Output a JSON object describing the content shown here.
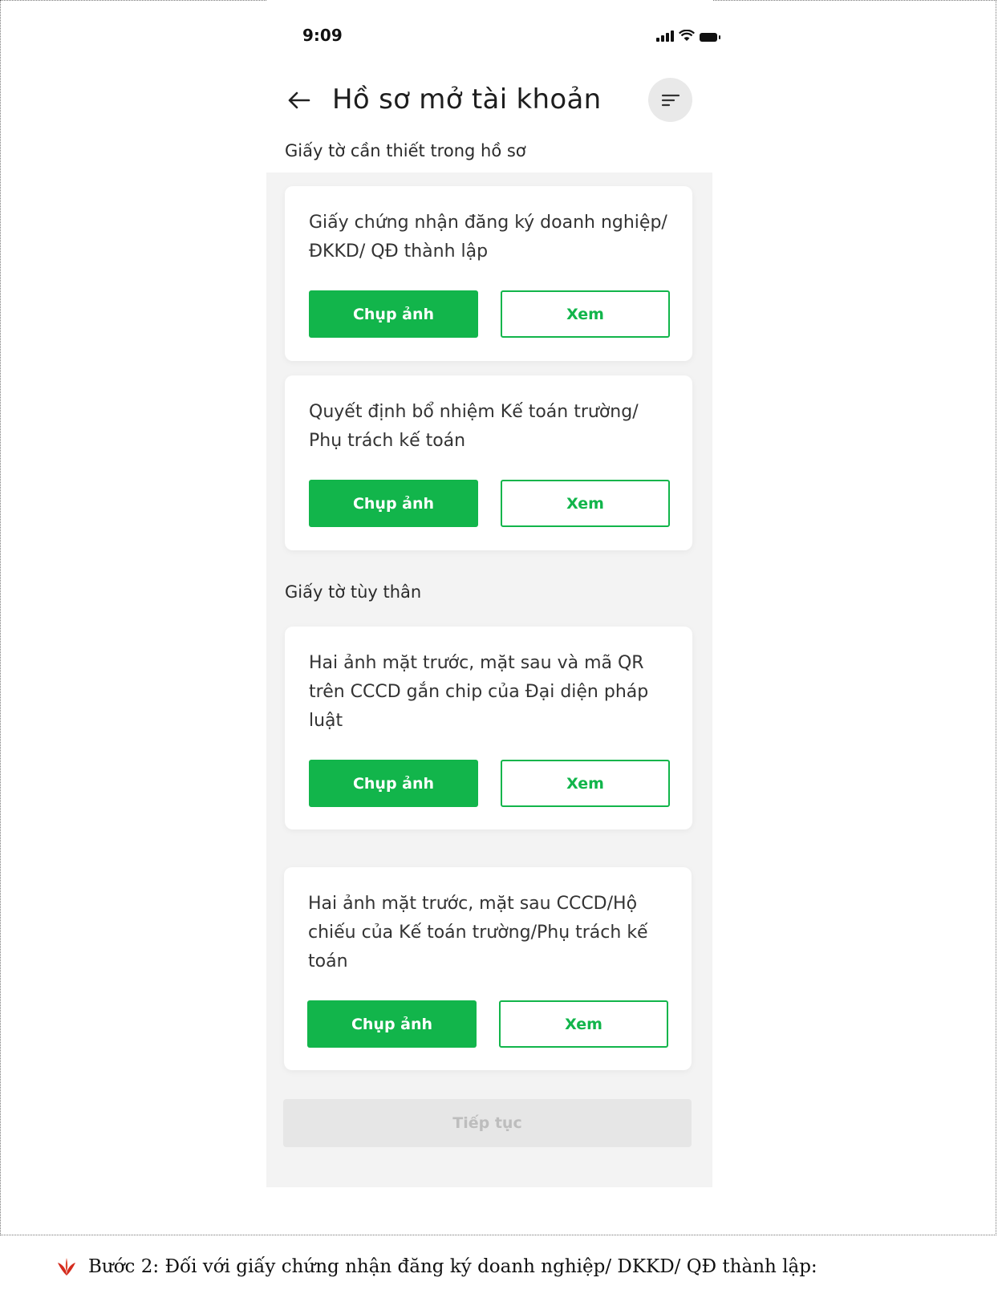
{
  "status_bar": {
    "time": "9:09"
  },
  "header": {
    "title": "Hồ sơ mở tài khoản"
  },
  "sections": [
    {
      "title": "Giấy tờ cần thiết trong hồ sơ",
      "cards": [
        {
          "text": "Giấy chứng nhận đăng ký doanh nghiệp/ ĐKKD/ QĐ thành lập",
          "primary": "Chụp ảnh",
          "secondary": "Xem"
        },
        {
          "text": "Quyết định bổ nhiệm Kế toán trường/ Phụ trách kế toán",
          "primary": "Chụp ảnh",
          "secondary": "Xem"
        }
      ]
    },
    {
      "title": "Giấy tờ tùy thân",
      "cards": [
        {
          "text": "Hai ảnh mặt trước, mặt sau và mã QR trên CCCD gắn chip của Đại diện pháp luật",
          "primary": "Chụp ảnh",
          "secondary": "Xem"
        },
        {
          "text": "Hai ảnh mặt trước, mặt sau CCCD/Hộ chiếu của Kế toán trường/Phụ trách kế toán",
          "primary": "Chụp ảnh",
          "secondary": "Xem"
        }
      ]
    }
  ],
  "footer": {
    "continue_label": "Tiếp tục"
  },
  "caption": {
    "text": "Bước 2: Đối với giấy chứng nhận đăng ký doanh nghiệp/ DKKD/ QĐ thành lập:"
  },
  "colors": {
    "accent": "#12b54b",
    "disabled_bg": "#e6e6e6",
    "disabled_text": "#bdbdbd",
    "bullet": "#d42a1c"
  },
  "icons": {
    "back": "arrow-left-icon",
    "filter": "filter-lines-icon",
    "bullet": "leaf-bullet-icon"
  }
}
